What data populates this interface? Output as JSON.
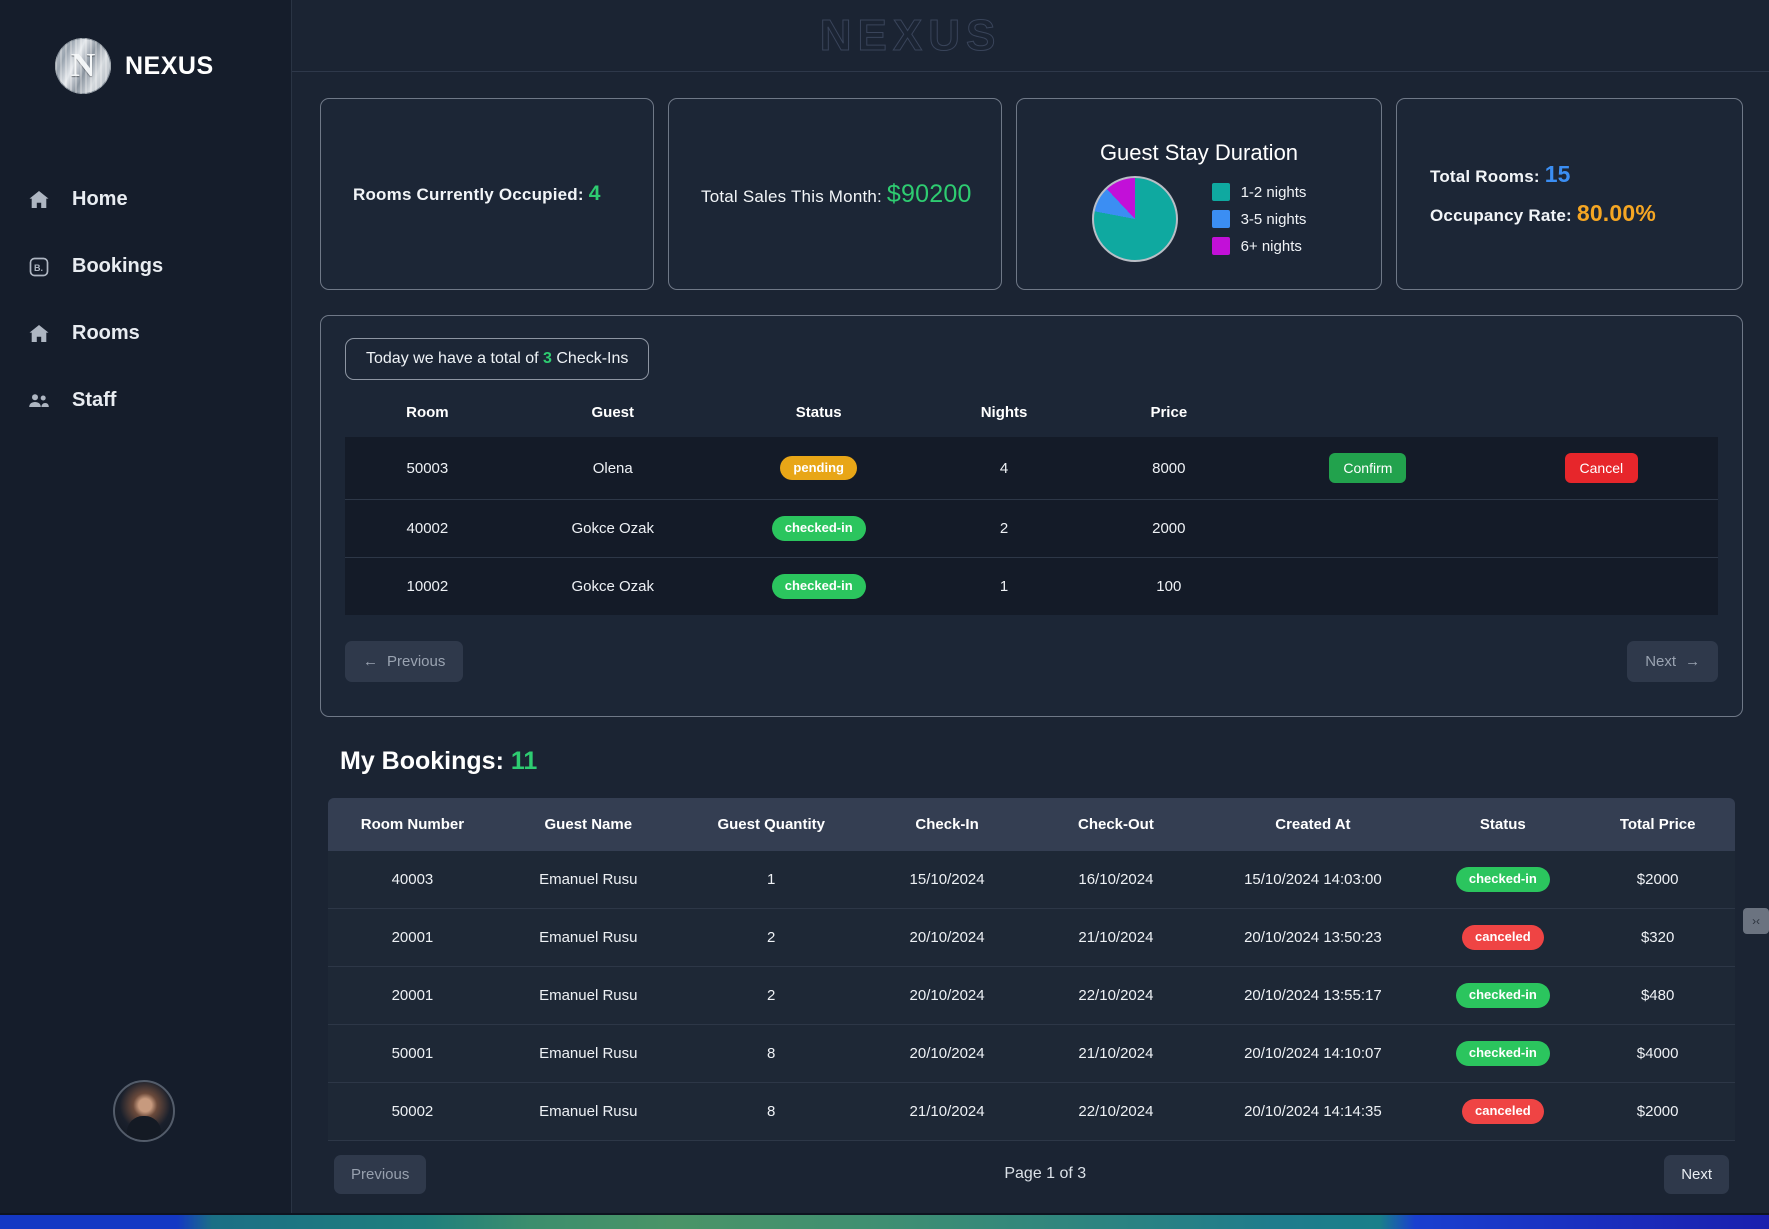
{
  "sidebar": {
    "brand": {
      "name": "NEXUS",
      "logo_icon": "nexus-monogram-icon"
    },
    "items": [
      {
        "label": "Home",
        "icon": "home-icon"
      },
      {
        "label": "Bookings",
        "icon": "booking-icon"
      },
      {
        "label": "Rooms",
        "icon": "home-icon"
      },
      {
        "label": "Staff",
        "icon": "people-icon"
      }
    ],
    "avatar_alt": "user-avatar"
  },
  "header": {
    "title": "NEXUS"
  },
  "cards": {
    "occupied": {
      "label": "Rooms Currently Occupied:",
      "value": "4"
    },
    "sales": {
      "label": "Total Sales This Month:",
      "value": "$90200"
    },
    "stay": {
      "title": "Guest Stay Duration",
      "legend": [
        {
          "label": "1-2 nights",
          "color": "#0fa9a0"
        },
        {
          "label": "3-5 nights",
          "color": "#3b8ef3"
        },
        {
          "label": "6+ nights",
          "color": "#c210d8"
        }
      ]
    },
    "rooms": {
      "total_label": "Total Rooms:",
      "total_value": "15",
      "occupancy_label": "Occupancy Rate:",
      "occupancy_value": "80.00%"
    }
  },
  "chart_data": {
    "type": "pie",
    "title": "Guest Stay Duration",
    "categories": [
      "1-2 nights",
      "3-5 nights",
      "6+ nights"
    ],
    "values": [
      78,
      10,
      12
    ],
    "colors": [
      "#0fa9a0",
      "#3b8ef3",
      "#c210d8"
    ],
    "legend_position": "right",
    "grid": false
  },
  "checkins": {
    "summary_prefix": "Today we have a total of",
    "summary_count": "3",
    "summary_suffix": "Check-Ins",
    "columns": [
      "Room",
      "Guest",
      "Status",
      "Nights",
      "Price",
      "",
      ""
    ],
    "rows": [
      {
        "room": "50003",
        "guest": "Olena",
        "status": "pending",
        "status_kind": "pending",
        "nights": "4",
        "price": "8000",
        "confirm": "Confirm",
        "cancel": "Cancel"
      },
      {
        "room": "40002",
        "guest": "Gokce Ozak",
        "status": "checked-in",
        "status_kind": "checked-in",
        "nights": "2",
        "price": "2000",
        "confirm": "",
        "cancel": ""
      },
      {
        "room": "10002",
        "guest": "Gokce Ozak",
        "status": "checked-in",
        "status_kind": "checked-in",
        "nights": "1",
        "price": "100",
        "confirm": "",
        "cancel": ""
      }
    ],
    "previous_label": "Previous",
    "next_label": "Next"
  },
  "bookings": {
    "heading_label": "My Bookings:",
    "heading_count": "11",
    "columns": [
      "Room Number",
      "Guest Name",
      "Guest Quantity",
      "Check-In",
      "Check-Out",
      "Created At",
      "Status",
      "Total Price"
    ],
    "rows": [
      {
        "room": "40003",
        "guest": "Emanuel Rusu",
        "qty": "1",
        "checkin": "15/10/2024",
        "checkout": "16/10/2024",
        "created": "15/10/2024 14:03:00",
        "status": "checked-in",
        "status_kind": "checked-in",
        "price": "$2000"
      },
      {
        "room": "20001",
        "guest": "Emanuel Rusu",
        "qty": "2",
        "checkin": "20/10/2024",
        "checkout": "21/10/2024",
        "created": "20/10/2024 13:50:23",
        "status": "canceled",
        "status_kind": "canceled",
        "price": "$320"
      },
      {
        "room": "20001",
        "guest": "Emanuel Rusu",
        "qty": "2",
        "checkin": "20/10/2024",
        "checkout": "22/10/2024",
        "created": "20/10/2024 13:55:17",
        "status": "checked-in",
        "status_kind": "checked-in",
        "price": "$480"
      },
      {
        "room": "50001",
        "guest": "Emanuel Rusu",
        "qty": "8",
        "checkin": "20/10/2024",
        "checkout": "21/10/2024",
        "created": "20/10/2024 14:10:07",
        "status": "checked-in",
        "status_kind": "checked-in",
        "price": "$4000"
      },
      {
        "room": "50002",
        "guest": "Emanuel Rusu",
        "qty": "8",
        "checkin": "21/10/2024",
        "checkout": "22/10/2024",
        "created": "20/10/2024 14:14:35",
        "status": "canceled",
        "status_kind": "canceled",
        "price": "$2000"
      }
    ],
    "previous_label": "Previous",
    "page_status": "Page 1 of 3",
    "next_label": "Next"
  }
}
